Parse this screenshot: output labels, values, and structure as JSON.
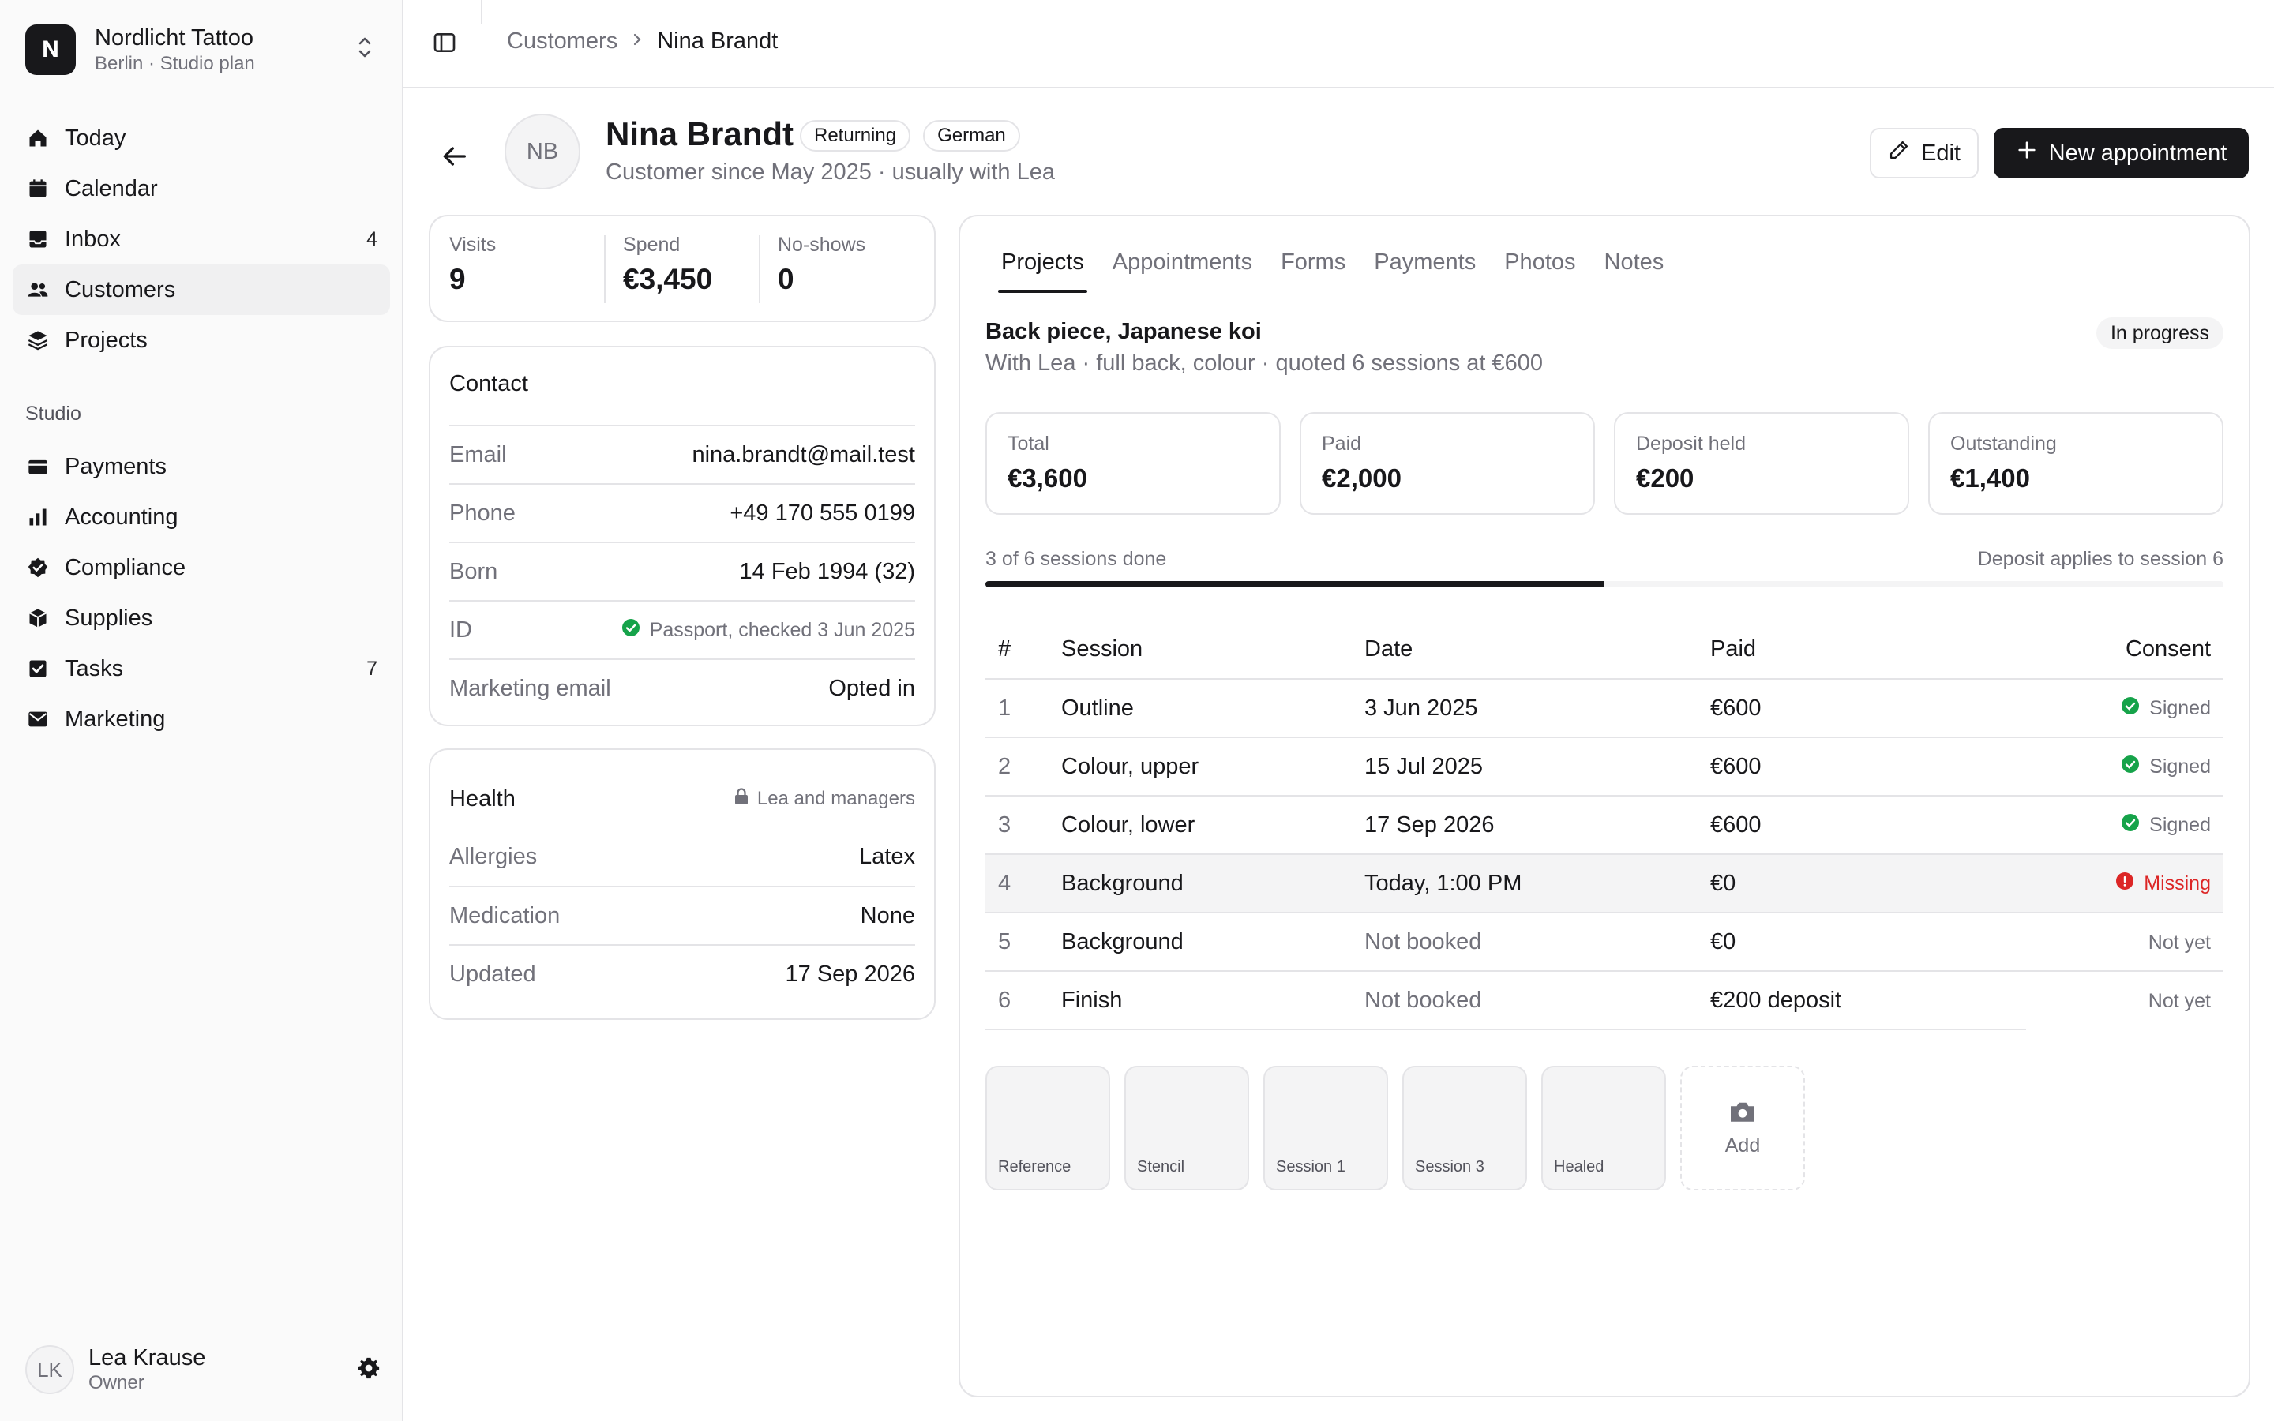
{
  "brand": {
    "logo_letter": "N",
    "name": "Nordlicht Tattoo",
    "subtitle": "Berlin · Studio plan"
  },
  "nav": {
    "primary": [
      {
        "label": "Today",
        "icon": "home-icon"
      },
      {
        "label": "Calendar",
        "icon": "calendar-icon"
      },
      {
        "label": "Inbox",
        "icon": "inbox-icon",
        "count": "4"
      },
      {
        "label": "Customers",
        "icon": "users-icon",
        "active": true
      },
      {
        "label": "Projects",
        "icon": "layers-icon"
      }
    ],
    "section_label": "Studio",
    "studio": [
      {
        "label": "Payments",
        "icon": "wallet-icon"
      },
      {
        "label": "Accounting",
        "icon": "bar-chart-icon"
      },
      {
        "label": "Compliance",
        "icon": "badge-check-icon"
      },
      {
        "label": "Supplies",
        "icon": "box-icon"
      },
      {
        "label": "Tasks",
        "icon": "checkbox-icon",
        "count": "7"
      },
      {
        "label": "Marketing",
        "icon": "mail-icon"
      }
    ]
  },
  "user": {
    "initials": "LK",
    "name": "Lea Krause",
    "role": "Owner"
  },
  "breadcrumb": {
    "parent": "Customers",
    "current": "Nina Brandt"
  },
  "customer": {
    "initials": "NB",
    "name": "Nina Brandt",
    "badges": [
      "Returning",
      "German"
    ],
    "subtitle": "Customer since May 2025 · usually with Lea"
  },
  "actions": {
    "edit": "Edit",
    "new_appointment": "New appointment"
  },
  "stats": [
    {
      "label": "Visits",
      "value": "9"
    },
    {
      "label": "Spend",
      "value": "€3,450"
    },
    {
      "label": "No-shows",
      "value": "0"
    }
  ],
  "contact": {
    "title": "Contact",
    "rows": [
      {
        "label": "Email",
        "value": "nina.brandt@mail.test"
      },
      {
        "label": "Phone",
        "value": "+49 170 555 0199"
      },
      {
        "label": "Born",
        "value": "14 Feb 1994 (32)"
      },
      {
        "label": "ID",
        "value": "Passport, checked 3 Jun 2025"
      },
      {
        "label": "Marketing email",
        "value": "Opted in"
      }
    ]
  },
  "health": {
    "title": "Health",
    "access": "Lea and managers",
    "rows": [
      {
        "label": "Allergies",
        "value": "Latex"
      },
      {
        "label": "Medication",
        "value": "None"
      },
      {
        "label": "Updated",
        "value": "17 Sep 2026"
      }
    ]
  },
  "tabs": [
    "Projects",
    "Appointments",
    "Forms",
    "Payments",
    "Photos",
    "Notes"
  ],
  "project": {
    "title": "Back piece, Japanese koi",
    "subtitle": "With Lea · full back, colour · quoted 6 sessions at €600",
    "status": "In progress",
    "money": [
      {
        "label": "Total",
        "value": "€3,600"
      },
      {
        "label": "Paid",
        "value": "€2,000"
      },
      {
        "label": "Deposit held",
        "value": "€200"
      },
      {
        "label": "Outstanding",
        "value": "€1,400"
      }
    ],
    "progress_text": "3 of 6 sessions done",
    "progress_fraction": 0.5,
    "deposit_note": "Deposit applies to session 6",
    "columns": [
      "#",
      "Session",
      "Date",
      "Paid",
      "Consent"
    ],
    "sessions": [
      {
        "num": "1",
        "session": "Outline",
        "date": "3 Jun 2025",
        "paid": "€600",
        "consent": "Signed"
      },
      {
        "num": "2",
        "session": "Colour, upper",
        "date": "15 Jul 2025",
        "paid": "€600",
        "consent": "Signed"
      },
      {
        "num": "3",
        "session": "Colour, lower",
        "date": "17 Sep 2026",
        "paid": "€600",
        "consent": "Signed"
      },
      {
        "num": "4",
        "session": "Background",
        "date": "Today, 1:00 PM",
        "paid": "€0",
        "consent": "Missing"
      },
      {
        "num": "5",
        "session": "Background",
        "date": "Not booked",
        "paid": "€0",
        "consent": "Not yet"
      },
      {
        "num": "6",
        "session": "Finish",
        "date": "Not booked",
        "paid": "€200 deposit",
        "consent": "Not yet"
      }
    ],
    "photos": [
      "Reference",
      "Stencil",
      "Session 1",
      "Session 3",
      "Healed"
    ],
    "add_photo": "Add"
  },
  "colors": {
    "accent": "#18181b",
    "success": "#16a34a",
    "danger": "#dc2626",
    "muted": "#71717a",
    "border": "#e4e4e7"
  }
}
